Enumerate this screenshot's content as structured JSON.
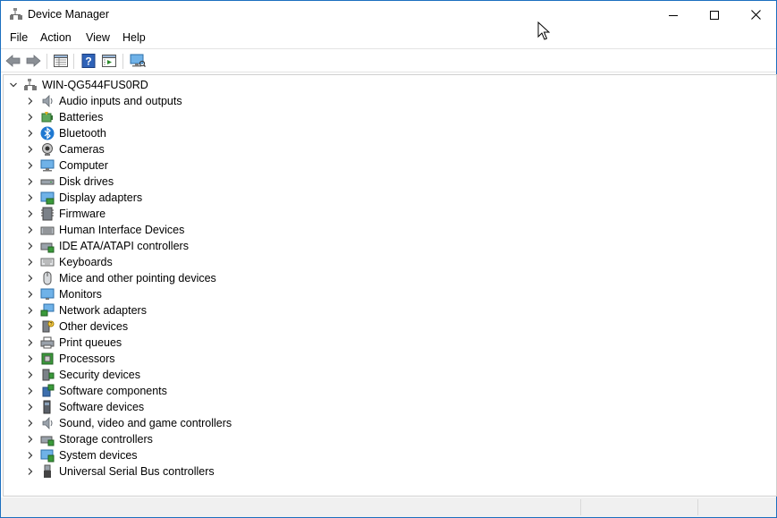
{
  "window": {
    "title": "Device Manager",
    "controls": {
      "minimize": "—",
      "maximize": "□",
      "close": "✕"
    }
  },
  "menu": [
    "File",
    "Action",
    "View",
    "Help"
  ],
  "toolbar": {
    "buttons": [
      "back-icon",
      "forward-icon",
      "properties-grid-icon",
      "help-icon",
      "run-pane-icon",
      "monitor-scan-icon"
    ]
  },
  "tree": {
    "root": {
      "label": "WIN-QG544FUS0RD",
      "icon": "computer-tree-icon",
      "expanded": true
    },
    "categories": [
      {
        "label": "Audio inputs and outputs",
        "icon": "speaker-icon"
      },
      {
        "label": "Batteries",
        "icon": "battery-icon"
      },
      {
        "label": "Bluetooth",
        "icon": "bluetooth-icon"
      },
      {
        "label": "Cameras",
        "icon": "camera-icon"
      },
      {
        "label": "Computer",
        "icon": "computer-icon"
      },
      {
        "label": "Disk drives",
        "icon": "disk-drive-icon"
      },
      {
        "label": "Display adapters",
        "icon": "display-adapter-icon"
      },
      {
        "label": "Firmware",
        "icon": "firmware-icon"
      },
      {
        "label": "Human Interface Devices",
        "icon": "hid-icon"
      },
      {
        "label": "IDE ATA/ATAPI controllers",
        "icon": "ide-controller-icon"
      },
      {
        "label": "Keyboards",
        "icon": "keyboard-icon"
      },
      {
        "label": "Mice and other pointing devices",
        "icon": "mouse-icon"
      },
      {
        "label": "Monitors",
        "icon": "monitor-icon"
      },
      {
        "label": "Network adapters",
        "icon": "network-icon"
      },
      {
        "label": "Other devices",
        "icon": "other-device-icon"
      },
      {
        "label": "Print queues",
        "icon": "printer-icon"
      },
      {
        "label": "Processors",
        "icon": "processor-icon"
      },
      {
        "label": "Security devices",
        "icon": "security-device-icon"
      },
      {
        "label": "Software components",
        "icon": "software-component-icon"
      },
      {
        "label": "Software devices",
        "icon": "software-device-icon"
      },
      {
        "label": "Sound, video and game controllers",
        "icon": "sound-controller-icon"
      },
      {
        "label": "Storage controllers",
        "icon": "storage-controller-icon"
      },
      {
        "label": "System devices",
        "icon": "system-device-icon"
      },
      {
        "label": "Universal Serial Bus controllers",
        "icon": "usb-icon"
      }
    ]
  },
  "colors": {
    "accent": "#1c6fbf",
    "icon_blue": "#3c8fd6",
    "icon_green": "#3a9a3a"
  }
}
